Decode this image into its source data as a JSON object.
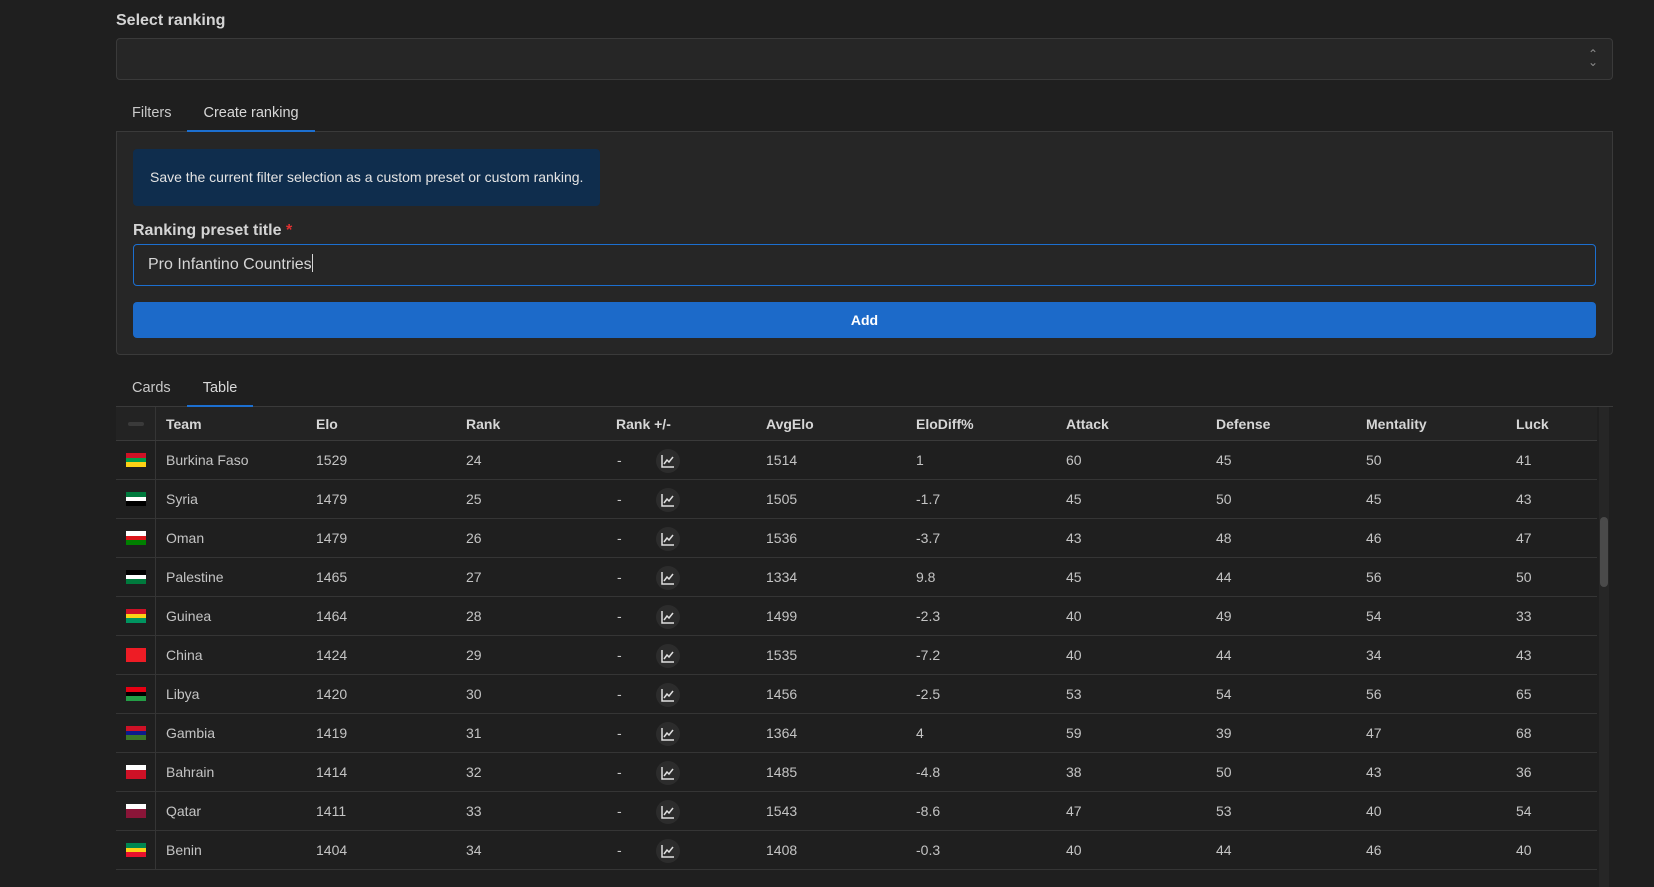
{
  "select": {
    "label": "Select ranking",
    "value": ""
  },
  "tabs1": [
    {
      "label": "Filters"
    },
    {
      "label": "Create ranking"
    }
  ],
  "create": {
    "info": "Save the current filter selection as a custom preset or custom ranking.",
    "field_label": "Ranking preset title",
    "required_mark": "*",
    "field_value": "Pro Infantino Countries",
    "add_label": "Add"
  },
  "tabs2": [
    {
      "label": "Cards"
    },
    {
      "label": "Table"
    }
  ],
  "table": {
    "columns": [
      "Team",
      "Elo",
      "Rank",
      "Rank +/-",
      "AvgElo",
      "EloDiff%",
      "Attack",
      "Defense",
      "Mentality",
      "Luck"
    ],
    "rows": [
      {
        "team": "Burkina Faso",
        "elo": "1529",
        "rank": "24",
        "rpm": "-",
        "avg": "1514",
        "diff": "1",
        "att": "60",
        "def": "45",
        "men": "50",
        "luck": "41",
        "flag": [
          "#ce1126",
          "#009e49",
          "#fcd116"
        ]
      },
      {
        "team": "Syria",
        "elo": "1479",
        "rank": "25",
        "rpm": "-",
        "avg": "1505",
        "diff": "-1.7",
        "att": "45",
        "def": "50",
        "men": "45",
        "luck": "43",
        "flag": [
          "#007a3d",
          "#ffffff",
          "#000000"
        ]
      },
      {
        "team": "Oman",
        "elo": "1479",
        "rank": "26",
        "rpm": "-",
        "avg": "1536",
        "diff": "-3.7",
        "att": "43",
        "def": "48",
        "men": "46",
        "luck": "47",
        "flag": [
          "#ffffff",
          "#db161b",
          "#008000"
        ]
      },
      {
        "team": "Palestine",
        "elo": "1465",
        "rank": "27",
        "rpm": "-",
        "avg": "1334",
        "diff": "9.8",
        "att": "45",
        "def": "44",
        "men": "56",
        "luck": "50",
        "flag": [
          "#000000",
          "#ffffff",
          "#007a3d"
        ]
      },
      {
        "team": "Guinea",
        "elo": "1464",
        "rank": "28",
        "rpm": "-",
        "avg": "1499",
        "diff": "-2.3",
        "att": "40",
        "def": "49",
        "men": "54",
        "luck": "33",
        "flag": [
          "#ce1126",
          "#fcd116",
          "#009460"
        ]
      },
      {
        "team": "China",
        "elo": "1424",
        "rank": "29",
        "rpm": "-",
        "avg": "1535",
        "diff": "-7.2",
        "att": "40",
        "def": "44",
        "men": "34",
        "luck": "43",
        "flag": [
          "#ee1c25",
          "#ee1c25",
          "#ee1c25"
        ]
      },
      {
        "team": "Libya",
        "elo": "1420",
        "rank": "30",
        "rpm": "-",
        "avg": "1456",
        "diff": "-2.5",
        "att": "53",
        "def": "54",
        "men": "56",
        "luck": "65",
        "flag": [
          "#e70013",
          "#000000",
          "#239e46"
        ]
      },
      {
        "team": "Gambia",
        "elo": "1419",
        "rank": "31",
        "rpm": "-",
        "avg": "1364",
        "diff": "4",
        "att": "59",
        "def": "39",
        "men": "47",
        "luck": "68",
        "flag": [
          "#ce1126",
          "#0c1c8c",
          "#3a7728"
        ]
      },
      {
        "team": "Bahrain",
        "elo": "1414",
        "rank": "32",
        "rpm": "-",
        "avg": "1485",
        "diff": "-4.8",
        "att": "38",
        "def": "50",
        "men": "43",
        "luck": "36",
        "flag": [
          "#ffffff",
          "#ce1126",
          "#ce1126"
        ]
      },
      {
        "team": "Qatar",
        "elo": "1411",
        "rank": "33",
        "rpm": "-",
        "avg": "1543",
        "diff": "-8.6",
        "att": "47",
        "def": "53",
        "men": "40",
        "luck": "54",
        "flag": [
          "#ffffff",
          "#8a1538",
          "#8a1538"
        ]
      },
      {
        "team": "Benin",
        "elo": "1404",
        "rank": "34",
        "rpm": "-",
        "avg": "1408",
        "diff": "-0.3",
        "att": "40",
        "def": "44",
        "men": "46",
        "luck": "40",
        "flag": [
          "#008751",
          "#fcd116",
          "#e8112d"
        ]
      }
    ]
  },
  "colors": {
    "accent": "#1c6ac9",
    "background": "#1f1f1f",
    "panel": "#262626",
    "info_bg": "#0f2d4d"
  }
}
